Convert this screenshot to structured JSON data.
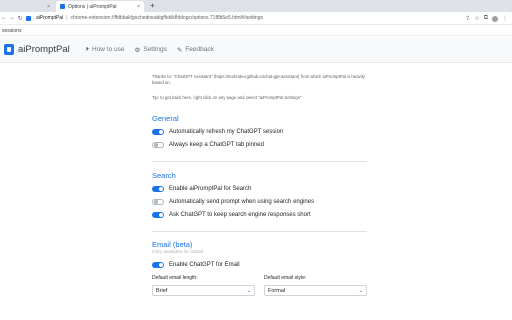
{
  "browser": {
    "tabs": [
      {
        "title": "",
        "close": "×"
      },
      {
        "title": "Options | aiPromptPal",
        "close": "×"
      }
    ],
    "new_tab": "+",
    "site_name": "aiPromptPal",
    "url_separator": "|",
    "url": "chrome-extension://ffdbbaklgochedneablgffeklkfhblogc/options.71f8b5e5.html#/settings",
    "bookmark": "sessions"
  },
  "app": {
    "brand": "aiPromptPal",
    "nav": [
      {
        "label": "How to use",
        "icon": "play-circle-icon"
      },
      {
        "label": "Settings",
        "icon": "gear-icon"
      },
      {
        "label": "Feedback",
        "icon": "megaphone-icon"
      }
    ]
  },
  "content": {
    "thanks": "Thanks to: \"ChatGPT Assistant\" (https://mohridev.github.io/chat-gpt-assistant) from which aiPromptPal is heavily based on.",
    "tip": "Tip: to get back here, right click on any page and select \"aiPromptPal Settings\"",
    "general": {
      "title": "General",
      "options": [
        {
          "label": "Automatically refresh my ChatGPT session",
          "enabled": true
        },
        {
          "label": "Always keep a ChatGPT tab pinned",
          "enabled": false
        }
      ]
    },
    "search": {
      "title": "Search",
      "options": [
        {
          "label": "Enable aiPromptPal for Search",
          "enabled": true
        },
        {
          "label": "Automatically send prompt when using search engines",
          "enabled": false
        },
        {
          "label": "Ask ChatGPT to keep search engine responses short",
          "enabled": true
        }
      ]
    },
    "email": {
      "title": "Email (beta)",
      "subtitle": "Only available for GMail",
      "toggle": {
        "label": "Enable ChatGPT for Email",
        "enabled": true
      },
      "length_label": "Default email length:",
      "length_value": "Brief",
      "style_label": "Default email style:",
      "style_value": "Formal"
    }
  },
  "colors": {
    "accent": "#1a73e8",
    "muted": "#6c757d"
  }
}
